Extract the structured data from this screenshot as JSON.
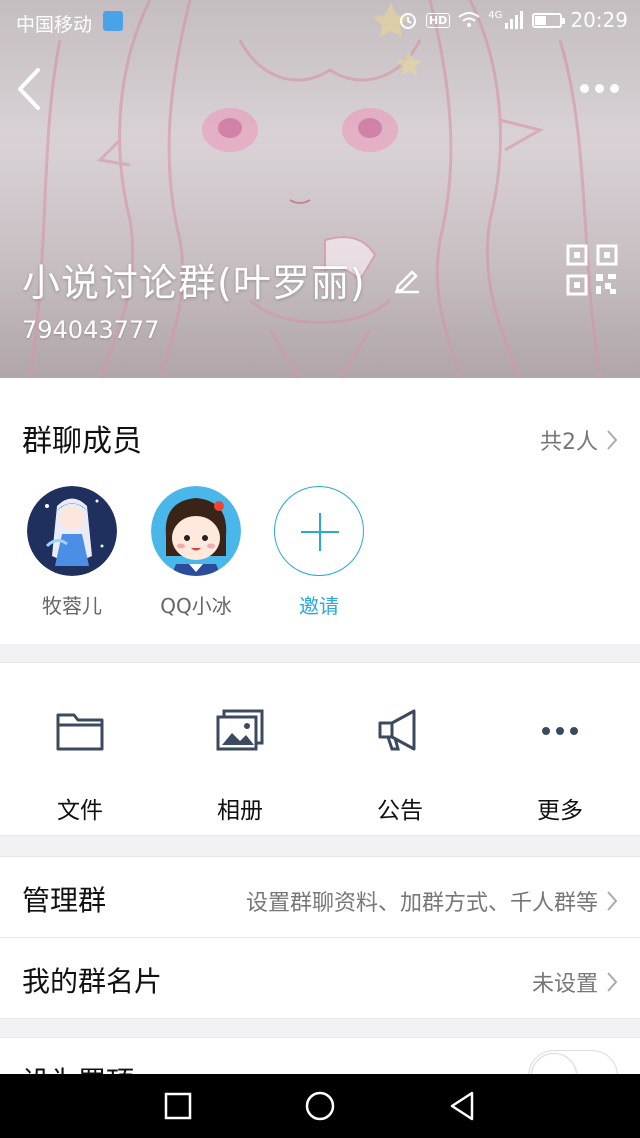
{
  "status_bar": {
    "carrier": "中国移动",
    "badge": "HD",
    "network": "4G",
    "time": "20:29"
  },
  "header": {
    "title": "小说讨论群(叶罗丽)",
    "group_id": "794043777"
  },
  "members": {
    "title": "群聊成员",
    "count": "共2人",
    "list": [
      {
        "name": "牧蓉儿"
      },
      {
        "name": "QQ小冰"
      }
    ],
    "invite_label": "邀请"
  },
  "tools": [
    {
      "label": "文件",
      "icon": "folder-icon"
    },
    {
      "label": "相册",
      "icon": "album-icon"
    },
    {
      "label": "公告",
      "icon": "megaphone-icon"
    },
    {
      "label": "更多",
      "icon": "more-dots-icon"
    }
  ],
  "settings": [
    {
      "label": "管理群",
      "value": "设置群聊资料、加群方式、千人群等"
    },
    {
      "label": "我的群名片",
      "value": "未设置"
    },
    {
      "label": "设为置顶"
    }
  ],
  "colors": {
    "accent": "#2aa7de",
    "text": "#111111",
    "secondary": "#777777"
  }
}
